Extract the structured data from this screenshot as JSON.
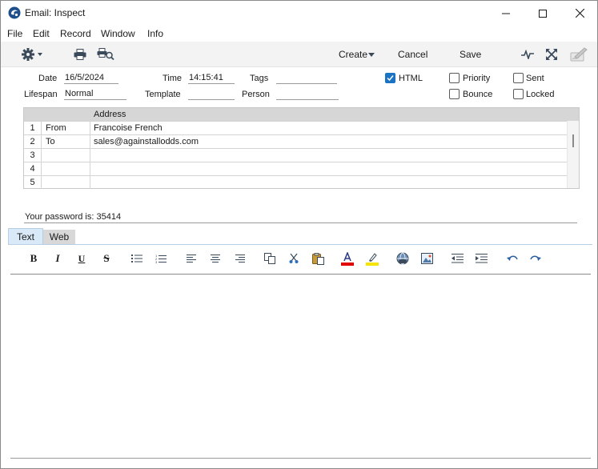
{
  "window": {
    "title": "Email: Inspect",
    "controls": [
      "minimize",
      "maximize",
      "close"
    ]
  },
  "menu": [
    "File",
    "Edit",
    "Record",
    "Window",
    "Info"
  ],
  "toolbar": {
    "create_label": "Create",
    "cancel_label": "Cancel",
    "save_label": "Save",
    "icons": [
      "gear-icon",
      "print-icon",
      "print-preview-icon",
      "activity-icon",
      "expand-icon",
      "sign-icon"
    ]
  },
  "form": {
    "date_label": "Date",
    "date_value": "16/5/2024",
    "time_label": "Time",
    "time_value": "14:15:41",
    "tags_label": "Tags",
    "tags_value": "",
    "lifespan_label": "Lifespan",
    "lifespan_value": "Normal",
    "template_label": "Template",
    "template_value": "",
    "person_label": "Person",
    "person_value": ""
  },
  "checkboxes": {
    "html": {
      "label": "HTML",
      "checked": true
    },
    "priority": {
      "label": "Priority",
      "checked": false
    },
    "sent": {
      "label": "Sent",
      "checked": false
    },
    "bounce": {
      "label": "Bounce",
      "checked": false
    },
    "locked": {
      "label": "Locked",
      "checked": false
    }
  },
  "recipients": {
    "header_address": "Address",
    "rows": [
      {
        "num": "1",
        "type": "From",
        "address": "Francoise French"
      },
      {
        "num": "2",
        "type": "To",
        "address": "sales@againstallodds.com"
      },
      {
        "num": "3",
        "type": "",
        "address": ""
      },
      {
        "num": "4",
        "type": "",
        "address": ""
      },
      {
        "num": "5",
        "type": "",
        "address": ""
      }
    ]
  },
  "subject": "Your password is: 35414",
  "tabs": {
    "text_label": "Text",
    "web_label": "Web",
    "active": "Text"
  },
  "editor_toolbar": [
    "bold",
    "italic",
    "underline",
    "strikethrough",
    "bulleted-list",
    "numbered-list",
    "align-left",
    "align-center",
    "align-right",
    "copy",
    "cut",
    "paste",
    "text-color",
    "highlight",
    "link",
    "image",
    "outdent",
    "indent",
    "undo",
    "redo"
  ],
  "colors": {
    "accent": "#1b73c4",
    "text_color_bar": "#e00000",
    "highlight_bar": "#f5e400"
  }
}
